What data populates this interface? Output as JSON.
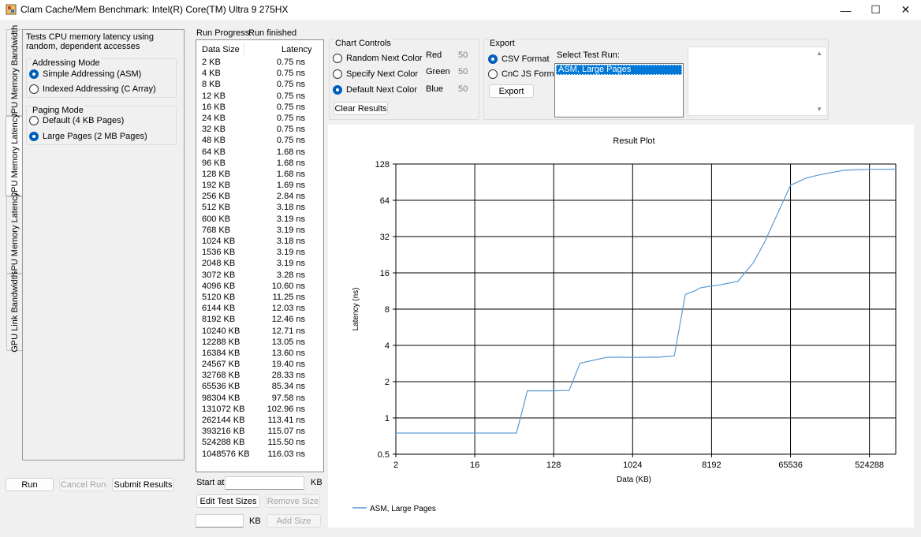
{
  "window": {
    "title": "Clam Cache/Mem Benchmark: Intel(R) Core(TM) Ultra 9 275HX",
    "minimize_glyph": "—",
    "maximize_glyph": "☐",
    "close_glyph": "✕"
  },
  "tabs": [
    "CPU Memory Bandwidth",
    "CPU Memory Latency",
    "GPU Memory Latency",
    "GPU Link Bandwidth"
  ],
  "left_panel": {
    "description": "Tests CPU memory latency using random, dependent accesses",
    "addressing_mode": {
      "title": "Addressing Mode",
      "options": [
        "Simple Addressing (ASM)",
        "Indexed Addressing (C Array)"
      ],
      "selected": 0
    },
    "paging_mode": {
      "title": "Paging Mode",
      "options": [
        "Default (4 KB Pages)",
        "Large Pages (2 MB Pages)"
      ],
      "selected": 1
    }
  },
  "bottom_buttons": {
    "run": "Run",
    "cancel_run": "Cancel Run",
    "submit_results": "Submit Results"
  },
  "progress": {
    "label": "Run Progress:",
    "status": "Run finished"
  },
  "results": {
    "columns": [
      "Data Size",
      "Latency"
    ],
    "rows": [
      [
        "2 KB",
        "0.75 ns"
      ],
      [
        "4 KB",
        "0.75 ns"
      ],
      [
        "8 KB",
        "0.75 ns"
      ],
      [
        "12 KB",
        "0.75 ns"
      ],
      [
        "16 KB",
        "0.75 ns"
      ],
      [
        "24 KB",
        "0.75 ns"
      ],
      [
        "32 KB",
        "0.75 ns"
      ],
      [
        "48 KB",
        "0.75 ns"
      ],
      [
        "64 KB",
        "1.68 ns"
      ],
      [
        "96 KB",
        "1.68 ns"
      ],
      [
        "128 KB",
        "1.68 ns"
      ],
      [
        "192 KB",
        "1.69 ns"
      ],
      [
        "256 KB",
        "2.84 ns"
      ],
      [
        "512 KB",
        "3.18 ns"
      ],
      [
        "600 KB",
        "3.19 ns"
      ],
      [
        "768 KB",
        "3.19 ns"
      ],
      [
        "1024 KB",
        "3.18 ns"
      ],
      [
        "1536 KB",
        "3.19 ns"
      ],
      [
        "2048 KB",
        "3.19 ns"
      ],
      [
        "3072 KB",
        "3.28 ns"
      ],
      [
        "4096 KB",
        "10.60 ns"
      ],
      [
        "5120 KB",
        "11.25 ns"
      ],
      [
        "6144 KB",
        "12.03 ns"
      ],
      [
        "8192 KB",
        "12.46 ns"
      ],
      [
        "10240 KB",
        "12.71 ns"
      ],
      [
        "12288 KB",
        "13.05 ns"
      ],
      [
        "16384 KB",
        "13.60 ns"
      ],
      [
        "24567 KB",
        "19.40 ns"
      ],
      [
        "32768 KB",
        "28.33 ns"
      ],
      [
        "65536 KB",
        "85.34 ns"
      ],
      [
        "98304 KB",
        "97.58 ns"
      ],
      [
        "131072 KB",
        "102.96 ns"
      ],
      [
        "262144 KB",
        "113.41 ns"
      ],
      [
        "393216 KB",
        "115.07 ns"
      ],
      [
        "524288 KB",
        "115.50 ns"
      ],
      [
        "1048576 KB",
        "116.03 ns"
      ]
    ]
  },
  "size_controls": {
    "start_at_label": "Start at",
    "start_at_value": "",
    "kb_unit": "KB",
    "edit_test_sizes": "Edit Test Sizes",
    "remove_size": "Remove Size",
    "add_size_value": "",
    "add_size": "Add Size"
  },
  "chart_controls": {
    "title": "Chart Controls",
    "options": [
      "Random Next Color",
      "Specify Next Color",
      "Default Next Color"
    ],
    "selected": 2,
    "red_label": "Red",
    "red_value": "50",
    "green_label": "Green",
    "green_value": "50",
    "blue_label": "Blue",
    "blue_value": "50",
    "clear_results": "Clear Results"
  },
  "export": {
    "title": "Export",
    "formats": [
      "CSV Format",
      "CnC JS Format"
    ],
    "selected": 0,
    "export_button": "Export",
    "select_run_label": "Select Test Run:",
    "runs": [
      "ASM, Large Pages"
    ],
    "selected_run": 0
  },
  "chart_data": {
    "type": "line",
    "title": "Result Plot",
    "xlabel": "Data (KB)",
    "ylabel": "Latency (ns)",
    "x_scale": "log2",
    "y_scale": "log2",
    "xlim": [
      2,
      1048576
    ],
    "ylim": [
      0.5,
      128
    ],
    "x_ticks": [
      2,
      16,
      128,
      1024,
      8192,
      65536,
      524288
    ],
    "x_tick_labels": [
      "2",
      "16",
      "128",
      "1024",
      "8192",
      "65536",
      "524288"
    ],
    "y_ticks": [
      0.5,
      1,
      2,
      4,
      8,
      16,
      32,
      64,
      128
    ],
    "y_tick_labels": [
      "0.5",
      "1",
      "2",
      "4",
      "8",
      "16",
      "32",
      "64",
      "128"
    ],
    "grid": true,
    "legend_position": "bottom-left",
    "series": [
      {
        "name": "ASM, Large Pages",
        "color": "#5b9bd5",
        "x": [
          2,
          4,
          8,
          12,
          16,
          24,
          32,
          48,
          64,
          96,
          128,
          192,
          256,
          512,
          600,
          768,
          1024,
          1536,
          2048,
          3072,
          4096,
          5120,
          6144,
          8192,
          10240,
          12288,
          16384,
          24567,
          32768,
          65536,
          98304,
          131072,
          262144,
          393216,
          524288,
          1048576
        ],
        "y": [
          0.75,
          0.75,
          0.75,
          0.75,
          0.75,
          0.75,
          0.75,
          0.75,
          1.68,
          1.68,
          1.68,
          1.69,
          2.84,
          3.18,
          3.19,
          3.19,
          3.18,
          3.19,
          3.19,
          3.28,
          10.6,
          11.25,
          12.03,
          12.46,
          12.71,
          13.05,
          13.6,
          19.4,
          28.33,
          85.34,
          97.58,
          102.96,
          113.41,
          115.07,
          115.5,
          116.03
        ]
      }
    ]
  }
}
